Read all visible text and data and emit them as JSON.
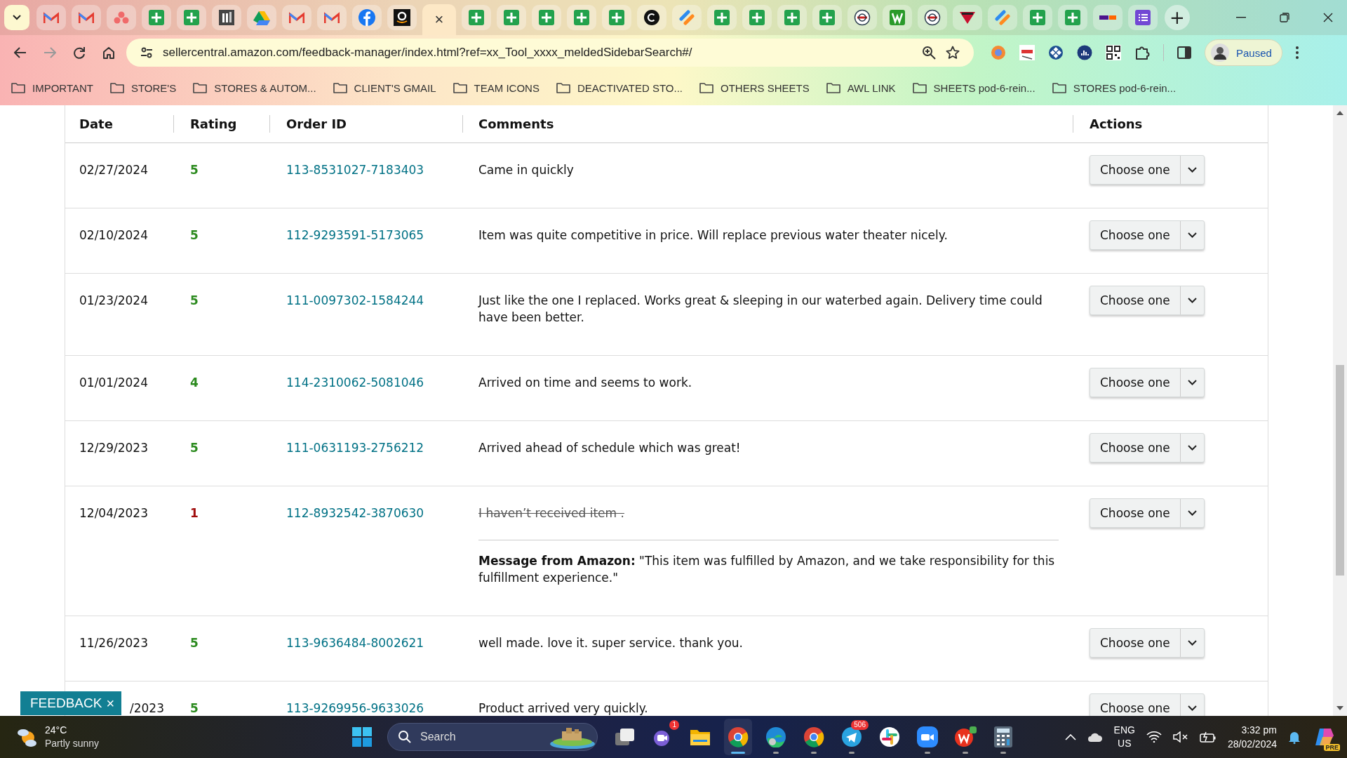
{
  "tabs": [
    {
      "kind": "mail",
      "selected": false
    },
    {
      "kind": "mail",
      "selected": false
    },
    {
      "kind": "dots",
      "selected": false
    },
    {
      "kind": "sheet",
      "selected": false
    },
    {
      "kind": "sheet",
      "selected": false
    },
    {
      "kind": "bars",
      "selected": false
    },
    {
      "kind": "drive",
      "selected": false
    },
    {
      "kind": "mail",
      "selected": false
    },
    {
      "kind": "mail",
      "selected": false
    },
    {
      "kind": "fb",
      "selected": false
    },
    {
      "kind": "amazon",
      "selected": false
    },
    {
      "kind": "active",
      "selected": true,
      "close": "×"
    },
    {
      "kind": "sheet",
      "selected": false
    },
    {
      "kind": "sheet",
      "selected": false
    },
    {
      "kind": "sheet",
      "selected": false
    },
    {
      "kind": "sheet",
      "selected": false
    },
    {
      "kind": "sheet",
      "selected": false
    },
    {
      "kind": "ccircle",
      "selected": false
    },
    {
      "kind": "stripes",
      "selected": false
    },
    {
      "kind": "sheet",
      "selected": false
    },
    {
      "kind": "sheet",
      "selected": false
    },
    {
      "kind": "sheet",
      "selected": false
    },
    {
      "kind": "sheet",
      "selected": false
    },
    {
      "kind": "roundel",
      "selected": false
    },
    {
      "kind": "wsquare",
      "selected": false
    },
    {
      "kind": "roundel",
      "selected": false
    },
    {
      "kind": "redtri",
      "selected": false
    },
    {
      "kind": "stripes",
      "selected": false
    },
    {
      "kind": "sheet",
      "selected": false
    },
    {
      "kind": "sheet",
      "selected": false
    },
    {
      "kind": "fedex",
      "selected": false
    },
    {
      "kind": "list",
      "selected": false
    }
  ],
  "new_tab": "+",
  "address_bar": {
    "url": "sellercentral.amazon.com/feedback-manager/index.html?ref=xx_Tool_xxxx_meldedSidebarSearch#/"
  },
  "profile": {
    "label": "Paused"
  },
  "bookmarks": [
    "IMPORTANT",
    "STORE'S",
    "STORES & AUTOM...",
    "CLIENT'S GMAIL",
    "TEAM ICONS",
    "DEACTIVATED STO...",
    "OTHERS SHEETS",
    "AWL LINK",
    "SHEETS pod-6-rein...",
    "STORES pod-6-rein..."
  ],
  "table": {
    "columns": [
      "Date",
      "Rating",
      "Order ID",
      "Comments",
      "Actions"
    ],
    "rows": [
      {
        "date": "02/27/2024",
        "rating": "5",
        "color": "#2b8a1e",
        "order_id": "113-8531027-7183403",
        "comment": "Came in quickly",
        "struck": false,
        "action": "Choose one"
      },
      {
        "date": "02/10/2024",
        "rating": "5",
        "color": "#2b8a1e",
        "order_id": "112-9293591-5173065",
        "comment": "Item was quite competitive in price. Will replace previous water theater nicely.",
        "struck": false,
        "action": "Choose one"
      },
      {
        "date": "01/23/2024",
        "rating": "5",
        "color": "#2b8a1e",
        "order_id": "111-0097302-1584244",
        "comment": "Just like the one I replaced. Works great & sleeping in our waterbed again. Delivery time could have been better.",
        "struck": false,
        "action": "Choose one"
      },
      {
        "date": "01/01/2024",
        "rating": "4",
        "color": "#2b8a1e",
        "order_id": "114-2310062-5081046",
        "comment": "Arrived on time and seems to work.",
        "struck": false,
        "action": "Choose one"
      },
      {
        "date": "12/29/2023",
        "rating": "5",
        "color": "#2b8a1e",
        "order_id": "111-0631193-2756212",
        "comment": "Arrived ahead of schedule which was great!",
        "struck": false,
        "action": "Choose one"
      },
      {
        "date": "12/04/2023",
        "rating": "1",
        "color": "#a00c0c",
        "order_id": "112-8932542-3870630",
        "comment": "I haven’t received item .",
        "struck": true,
        "message": "**Message from Amazon:** \"This item was fulfilled by Amazon, and we take responsibility for this fulfillment experience.\"",
        "action": "Choose one"
      },
      {
        "date": "11/26/2023",
        "rating": "5",
        "color": "#2b8a1e",
        "order_id": "113-9636484-8002621",
        "comment": "well made. love it. super service. thank you.",
        "struck": false,
        "action": "Choose one"
      },
      {
        "date": "/2023",
        "cut": true,
        "rating": "5",
        "color": "#2b8a1e",
        "order_id": "113-9269956-9633026",
        "comment": "Product arrived very quickly.",
        "struck": false,
        "action": "Choose one"
      }
    ]
  },
  "feedback_button": {
    "label": "FEEDBACK",
    "close": "×"
  },
  "taskbar": {
    "weather": {
      "temp": "24°C",
      "text": "Partly sunny"
    },
    "search": {
      "placeholder": "Search"
    },
    "apps": [
      {
        "kind": "taskview",
        "active": false,
        "running": false
      },
      {
        "kind": "teams",
        "active": false,
        "running": false,
        "badge": "1"
      },
      {
        "kind": "folder",
        "active": false,
        "running": false
      },
      {
        "kind": "chrome",
        "active": true,
        "running": true
      },
      {
        "kind": "edge",
        "active": false,
        "running": true
      },
      {
        "kind": "chrome",
        "active": false,
        "running": true
      },
      {
        "kind": "telegram",
        "active": false,
        "running": true,
        "badge": "506"
      },
      {
        "kind": "slack",
        "active": false,
        "running": false
      },
      {
        "kind": "zoom",
        "active": false,
        "running": true
      },
      {
        "kind": "wps",
        "active": false,
        "running": true
      },
      {
        "kind": "calc",
        "active": false,
        "running": true
      }
    ],
    "lang": [
      "ENG",
      "US"
    ],
    "time": "3:32 pm",
    "date": "28/02/2024",
    "copilot_badge": "PRE"
  }
}
